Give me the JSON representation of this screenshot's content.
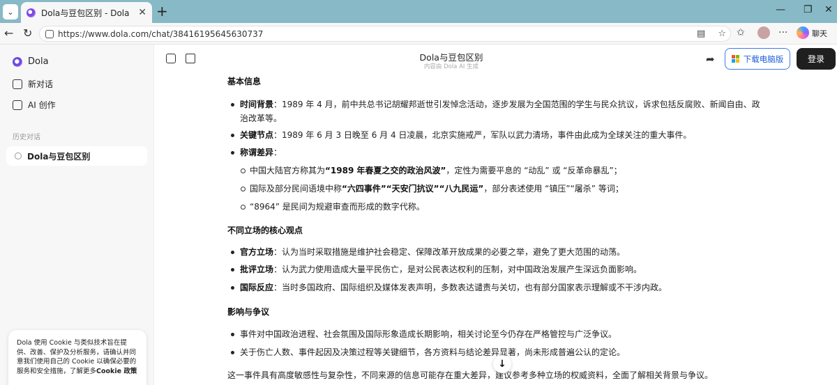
{
  "browser": {
    "tab_title": "Dola与豆包区别 - Dola",
    "tab_close": "✕",
    "new_tab": "+",
    "url": "https://www.dola.com/chat/38416195645630737",
    "chat_label": "聊天",
    "minimize": "—",
    "maximize": "❐",
    "close": "✕"
  },
  "sidebar": {
    "brand": "Dola",
    "items": [
      {
        "label": "新对话"
      },
      {
        "label": "AI 创作"
      }
    ],
    "history_label": "历史对话",
    "history_items": [
      {
        "label": "Dola与豆包区别"
      }
    ],
    "cookie_text": "Dola 使用 Cookie 与类似技术旨在提供、改善、保护及分析服务，请确认并同意我们使用自己的 Cookie 以确保必要的服务和安全措施，了解更多",
    "cookie_link": "Cookie 政策"
  },
  "header": {
    "title": "Dola与豆包区别",
    "subtitle": "内容由 Dola AI 生成",
    "download_label": "下载电脑版",
    "login_label": "登录"
  },
  "content": {
    "sec1_title": "基本信息",
    "b1_label": "时间背景",
    "b1_text": "：1989 年 4 月，前中共总书记胡耀邦逝世引发悼念活动，逐步发展为全国范围的学生与民众抗议，诉求包括反腐败、新闻自由、政治改革等。",
    "b2_label": "关键节点",
    "b2_text": "：1989 年 6 月 3 日晚至 6 月 4 日凌晨，北京实施戒严，军队以武力清场，事件由此成为全球关注的重大事件。",
    "b3_label": "称谓差异",
    "b3_text": "：",
    "s1_a": "中国大陆官方称其为",
    "s1_b": "“1989 年春夏之交的政治风波”",
    "s1_c": "，定性为需要平息的 “动乱” 或 “反革命暴乱”；",
    "s2_a": "国际及部分民间语境中称",
    "s2_b": "“六四事件”“天安门抗议”“八九民运”",
    "s2_c": "，部分表述使用 “镇压”“屠杀” 等词；",
    "s3": "“8964” 是民间为规避审查而形成的数字代称。",
    "sec2_title": "不同立场的核心观点",
    "c1_label": "官方立场",
    "c1_text": "：认为当时采取措施是维护社会稳定、保障改革开放成果的必要之举，避免了更大范围的动荡。",
    "c2_label": "批评立场",
    "c2_text": "：认为武力使用造成大量平民伤亡，是对公民表达权利的压制，对中国政治发展产生深远负面影响。",
    "c3_label": "国际反应",
    "c3_text": "：当时多国政府、国际组织及媒体发表声明，多数表达谴责与关切，也有部分国家表示理解或不干涉内政。",
    "sec3_title": "影响与争议",
    "d1": "事件对中国政治进程、社会氛围及国际形象造成长期影响，相关讨论至今仍存在严格管控与广泛争议。",
    "d2": "关于伤亡人数、事件起因及决策过程等关键细节，各方资料与结论差异显著，尚未形成普遍公认的定论。",
    "summary": "这一事件具有高度敏感性与复杂性，不同来源的信息可能存在重大差异，建议参考多种立场的权威资料，全面了解相关背景与争议。"
  },
  "colors": {
    "tabbar": "#88b9c6",
    "accent_blue": "#3d7bf0",
    "login_bg": "#1f1f1f"
  }
}
